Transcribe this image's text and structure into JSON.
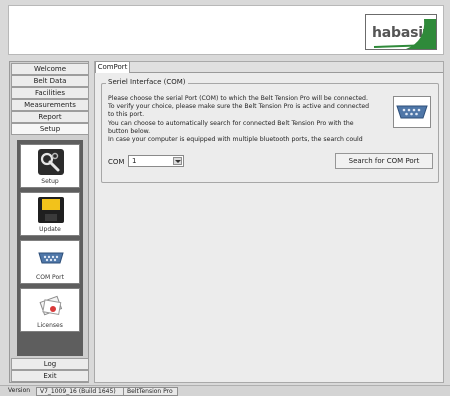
{
  "app": {
    "logo_text": "habasit",
    "brand_green": "#2f8a3a"
  },
  "sidebar": {
    "items": [
      {
        "label": "Welcome",
        "active": false
      },
      {
        "label": "Belt Data",
        "active": false
      },
      {
        "label": "Facilities",
        "active": false
      },
      {
        "label": "Measurements",
        "active": false
      },
      {
        "label": "Report",
        "active": false
      },
      {
        "label": "Setup",
        "active": true
      }
    ],
    "tools": [
      {
        "label": "Setup",
        "icon": "wrench-icon"
      },
      {
        "label": "Update",
        "icon": "floppy-disk-icon"
      },
      {
        "label": "COM Port",
        "icon": "serial-connector-icon"
      },
      {
        "label": "Licenses",
        "icon": "certificate-icon"
      }
    ],
    "bottom_items": [
      {
        "label": "Log"
      },
      {
        "label": "Exit"
      }
    ]
  },
  "main": {
    "tab_label": "ComPort",
    "group_title": "Seriel Interface (COM)",
    "description_lines": [
      "Please choose the serial Port (COM) to which the Belt Tension Pro will be connected.",
      "To verify your choice, please make sure the Belt Tension Pro is active and connected",
      "to this port.",
      "You can choose to automatically search for connected Belt Tension Pro with the",
      "button below.",
      "In case your computer is equipped with multiple bluetooth ports, the search could"
    ],
    "com_label": "COM",
    "com_value": "1",
    "search_button": "Search for COM Port"
  },
  "status": {
    "version_label": "Version",
    "version_value": "V7_1009_16 (Build 1645)",
    "device_value": "BeltTension Pro"
  }
}
